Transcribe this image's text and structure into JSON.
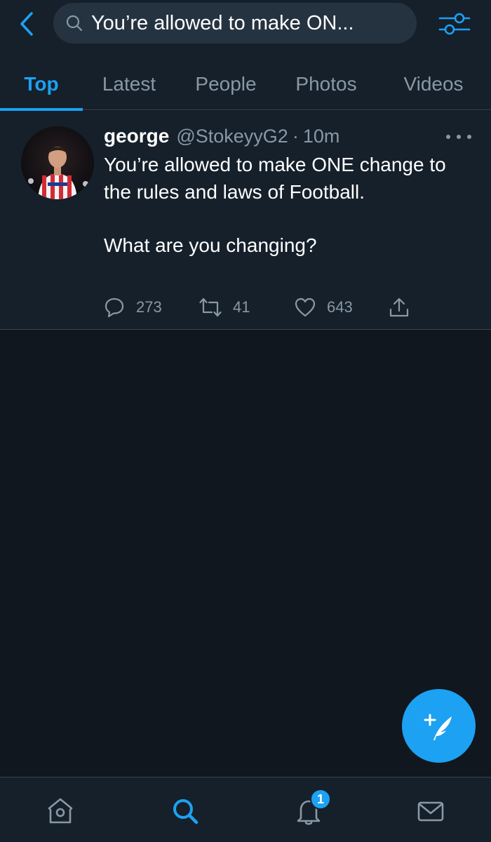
{
  "search": {
    "query": "You’re allowed to make ON..."
  },
  "tabs": [
    {
      "label": "Top",
      "active": true
    },
    {
      "label": "Latest",
      "active": false
    },
    {
      "label": "People",
      "active": false
    },
    {
      "label": "Photos",
      "active": false
    },
    {
      "label": "Videos",
      "active": false
    }
  ],
  "tweet": {
    "display_name": "george",
    "handle": "@StokeyyG2",
    "separator": "·",
    "time": "10m",
    "text_lines": [
      "You’re allowed to make ONE change to the rules and laws of Football.",
      "What are you changing?"
    ],
    "replies": "273",
    "retweets": "41",
    "likes": "643"
  },
  "bottom_nav": {
    "notifications_badge": "1"
  },
  "icons": {
    "back": "chevron-left-icon",
    "search": "search-icon",
    "filter": "sliders-icon",
    "reply": "comment-icon",
    "retweet": "retweet-icon",
    "like": "heart-icon",
    "share": "share-icon",
    "compose": "compose-icon",
    "home": "home-icon",
    "explore": "search-icon",
    "notifications": "bell-icon",
    "messages": "envelope-icon"
  },
  "colors": {
    "accent": "#1da1f2",
    "background": "#10171e",
    "surface": "#15202b",
    "muted": "#8899a6"
  }
}
